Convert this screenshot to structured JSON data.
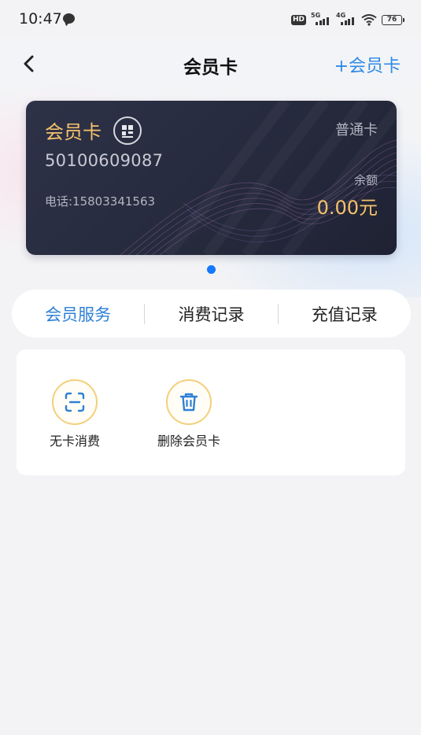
{
  "status_bar": {
    "time": "10:47",
    "hd_label": "HD",
    "net1_label": "5G",
    "net2_label": "4G",
    "battery": "76"
  },
  "nav": {
    "title": "会员卡",
    "add_label": "+会员卡"
  },
  "card": {
    "title": "会员卡",
    "number": "50100609087",
    "phone": "电话:15803341563",
    "type": "普通卡",
    "balance_label": "余额",
    "balance": "0.00元"
  },
  "tabs": [
    {
      "label": "会员服务",
      "active": true
    },
    {
      "label": "消费记录",
      "active": false
    },
    {
      "label": "充值记录",
      "active": false
    }
  ],
  "services": [
    {
      "label": "无卡消费",
      "icon": "scan-icon"
    },
    {
      "label": "删除会员卡",
      "icon": "trash-icon"
    }
  ],
  "colors": {
    "accent_blue": "#2e80d6",
    "gold": "#f4c26b",
    "card_bg": "#262a3d"
  }
}
